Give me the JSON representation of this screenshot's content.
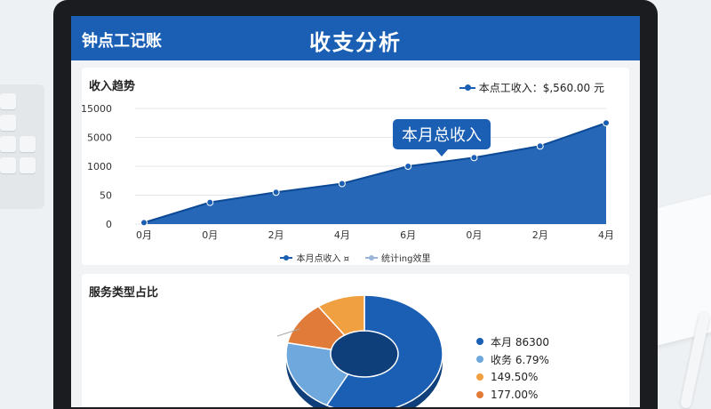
{
  "header": {
    "app_name": "钟点工记账",
    "page_title": "收支分析"
  },
  "trend_card": {
    "title": "收入趋势",
    "legend_label": "本点工收入：$,560.00 元",
    "tooltip": "本月总收入",
    "bottom_legend": [
      "本月点收入 ¤",
      "统计ing效里"
    ]
  },
  "service_card": {
    "title": "服务类型占比",
    "legend": [
      {
        "label": "本月 86300",
        "color": "#1a5fb4"
      },
      {
        "label": "收务 6.79%",
        "color": "#6ea8dc"
      },
      {
        "label": "149.50%",
        "color": "#f0a040"
      },
      {
        "label": "177.00%",
        "color": "#e07b39"
      }
    ]
  },
  "chart_data": [
    {
      "type": "area",
      "title": "收入趋势",
      "y_tick_labels": [
        "15000",
        "5000",
        "1000",
        "50",
        "0"
      ],
      "x_tick_labels": [
        "0月",
        "0月",
        "2月",
        "4月",
        "6月",
        "0月",
        "2月",
        "4月"
      ],
      "series": [
        {
          "name": "本月点收入",
          "values": [
            1,
            15,
            22,
            28,
            40,
            46,
            54,
            70
          ]
        }
      ]
    },
    {
      "type": "pie",
      "slices": [
        {
          "label": "本月 86300",
          "value": 58,
          "color": "#1a5fb4"
        },
        {
          "label": "收务 6.79%",
          "value": 20,
          "color": "#6ea8dc"
        },
        {
          "label": "149.50%",
          "value": 12,
          "color": "#e07b39"
        },
        {
          "label": "177.00%",
          "value": 10,
          "color": "#f0a040"
        }
      ]
    }
  ]
}
